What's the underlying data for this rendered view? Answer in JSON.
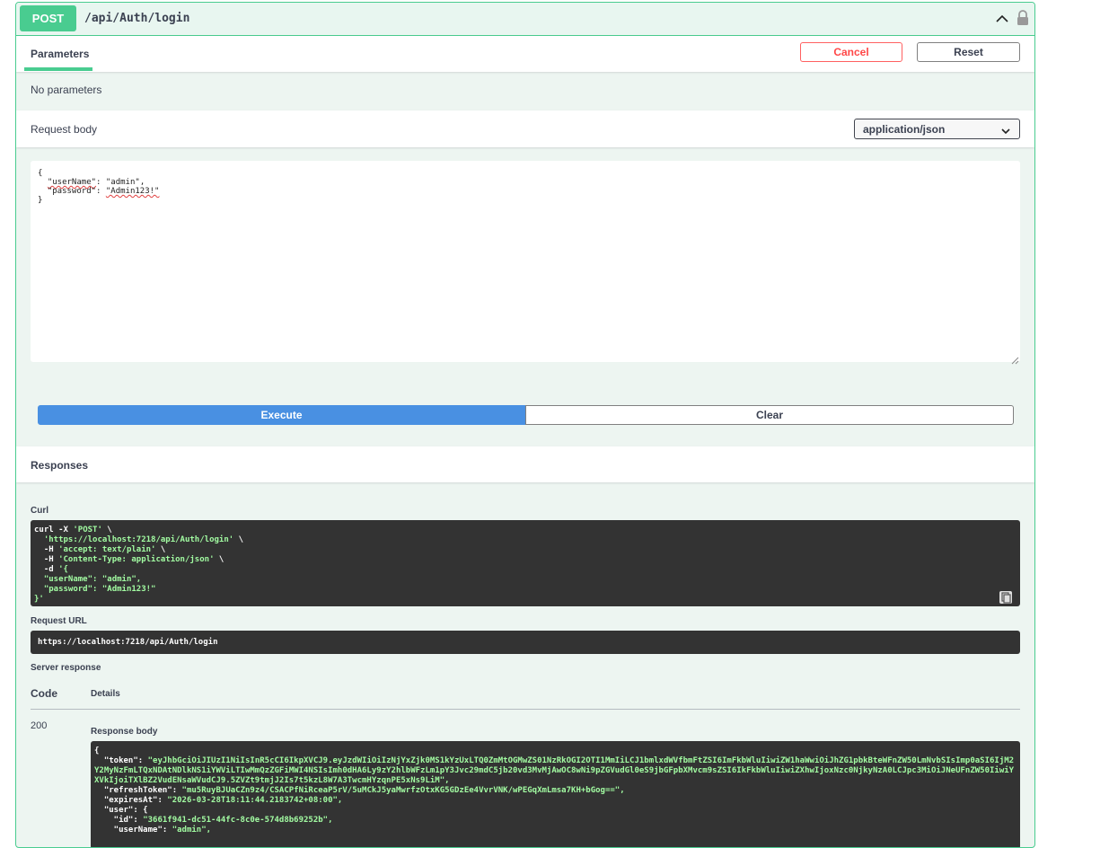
{
  "operation": {
    "method": "POST",
    "path": "/api/Auth/login"
  },
  "parameters": {
    "tab_label": "Parameters",
    "cancel_label": "Cancel",
    "reset_label": "Reset",
    "none_text": "No parameters"
  },
  "request_body": {
    "label": "Request body",
    "content_type": "application/json",
    "line_open": "{",
    "key_user": "\"userName\"",
    "val_user": "\"admin\"",
    "key_pass": "\"password\"",
    "val_pass": "\"Admin123!\"",
    "line_close": "}"
  },
  "actions": {
    "execute_label": "Execute",
    "clear_label": "Clear"
  },
  "responses": {
    "title": "Responses",
    "curl_label": "Curl",
    "curl_lines": [
      "curl -X ",
      "'POST'",
      " \\",
      "  'https://localhost:7218/api/Auth/login'",
      " \\",
      "  -H ",
      "'accept: text/plain'",
      " \\",
      "  -H ",
      "'Content-Type: application/json'",
      " \\",
      "  -d ",
      "'{",
      "  \"userName\": \"admin\",",
      "  \"password\": \"Admin123!\"",
      "}'"
    ],
    "request_url_label": "Request URL",
    "request_url": "https://localhost:7218/api/Auth/login",
    "server_response_label": "Server response",
    "code_header": "Code",
    "details_header": "Details",
    "status_code": "200",
    "response_body_label": "Response body",
    "body": {
      "open": "{",
      "token_key": "  \"token\": ",
      "token_val": "\"eyJhbGciOiJIUzI1NiIsInR5cCI6IkpXVCJ9.eyJzdWIiOiIzNjYxZjk0MS1kYzUxLTQ0ZmMtOGMwZS01NzRkOGI2OTI1MmIiLCJ1bmlxdWVfbmFtZSI6ImFkbWluIiwiZW1haWwiOiJhZG1pbkBteWFnZW50LmNvbSIsImp0aSI6IjM2Y2MyNzFmLTQxNDAtNDlkNS1iYWViLTIwMmQzZGFiMWI4NSIsImh0dHA6Ly9zY2hlbWFzLm1pY3Jvc29mdC5jb20vd3MvMjAwOC8wNi9pZGVudGl0eS9jbGFpbXMvcm9sZSI6IkFkbWluIiwiZXhwIjoxNzc0NjkyNzA0LCJpc3MiOiJNeUFnZW50IiwiYXVkIjoiTXlBZ2VudENsaWVudCJ9.5ZVZt9tmjJ2Is7t5kzL8W7A3TwcmHYzqnPE5xNs9LiM\",",
      "refresh_key": "  \"refreshToken\": ",
      "refresh_val": "\"mu5RuyBJUaCZn9z4/CSACPfNiRceaP5rV/5uMCkJ5yaMwrfzOtxKG5GDzEe4VvrVNK/wPEGqXmLmsa7KH+bGog==\",",
      "expires_key": "  \"expiresAt\": ",
      "expires_val": "\"2026-03-28T18:11:44.2183742+08:00\",",
      "user_key": "  \"user\": {",
      "id_key": "    \"id\": ",
      "id_val": "\"3661f941-dc51-44fc-8c0e-574d8b69252b\",",
      "username_key": "    \"userName\": ",
      "username_val": "\"admin\","
    }
  },
  "colors": {
    "post_green": "#49cc90",
    "execute_blue": "#4990e2",
    "cancel_red": "#ff6060",
    "code_bg": "#333333",
    "string_green": "#a2fca2"
  },
  "icons": [
    "chevron-up-icon",
    "lock-icon",
    "chevron-down-icon",
    "resize-handle-icon",
    "copy-icon"
  ]
}
